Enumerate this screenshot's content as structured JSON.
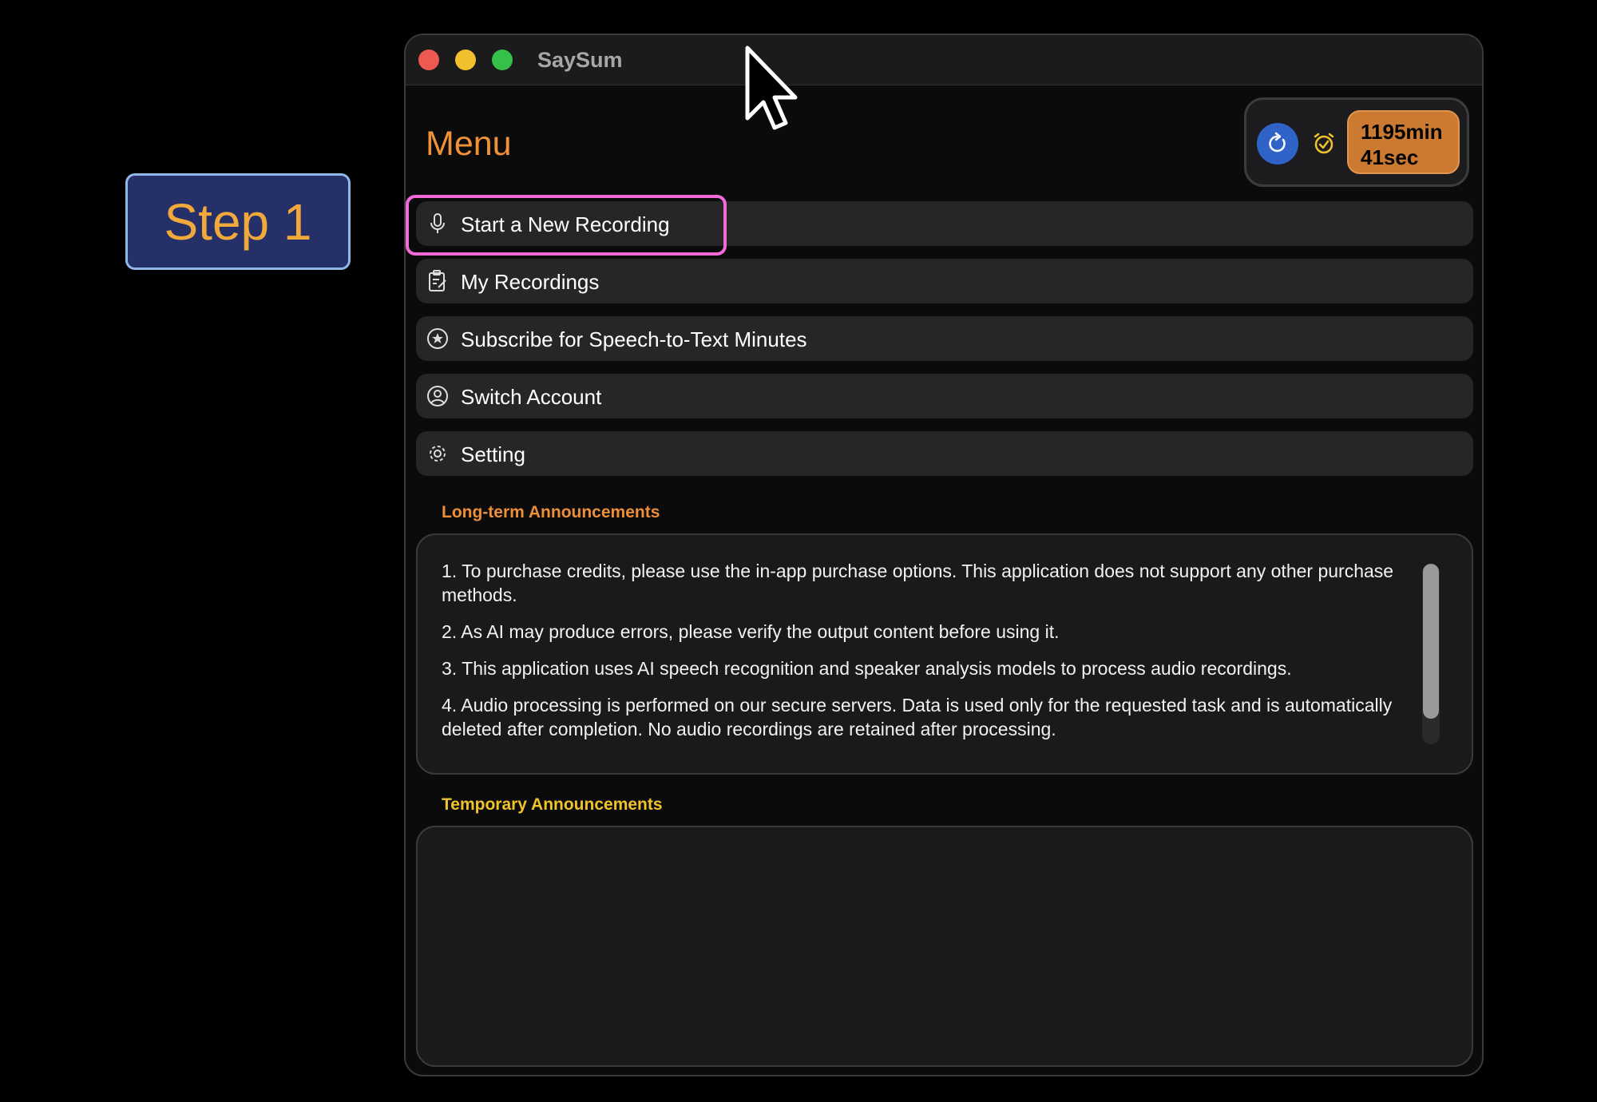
{
  "tutorial": {
    "step_label": "Step 1"
  },
  "window": {
    "app_title": "SaySum"
  },
  "header": {
    "menu_title": "Menu",
    "remaining_time": {
      "minutes": "1195min",
      "seconds": "41sec"
    }
  },
  "menu": {
    "items": [
      {
        "label": "Start a New Recording",
        "icon": "microphone-icon"
      },
      {
        "label": "My Recordings",
        "icon": "clipboard-edit-icon"
      },
      {
        "label": "Subscribe for Speech-to-Text Minutes",
        "icon": "star-circle-icon"
      },
      {
        "label": "Switch Account",
        "icon": "person-circle-icon"
      },
      {
        "label": "Setting",
        "icon": "gear-icon"
      }
    ],
    "highlighted_item": "Start a New Recording"
  },
  "long_term_announcements": {
    "label": "Long-term Announcements",
    "items": [
      "1. To purchase credits, please use the in-app purchase options. This application does not support any other purchase methods.",
      "2. As AI may produce errors, please verify the output content before using it.",
      "3. This application uses AI speech recognition and speaker analysis models to process audio recordings.",
      "4. Audio processing is performed on our secure servers. Data is used only for the requested task and is automatically deleted after completion. No audio recordings are retained after processing."
    ]
  },
  "temporary_announcements": {
    "label": "Temporary Announcements",
    "items": []
  },
  "colors": {
    "accent_orange": "#f0913a",
    "accent_yellow": "#f0c22c",
    "highlight_pink": "#f06ad8",
    "refresh_blue": "#2f63c7",
    "time_badge": "#cc7a31",
    "step_badge_bg": "#253069"
  }
}
